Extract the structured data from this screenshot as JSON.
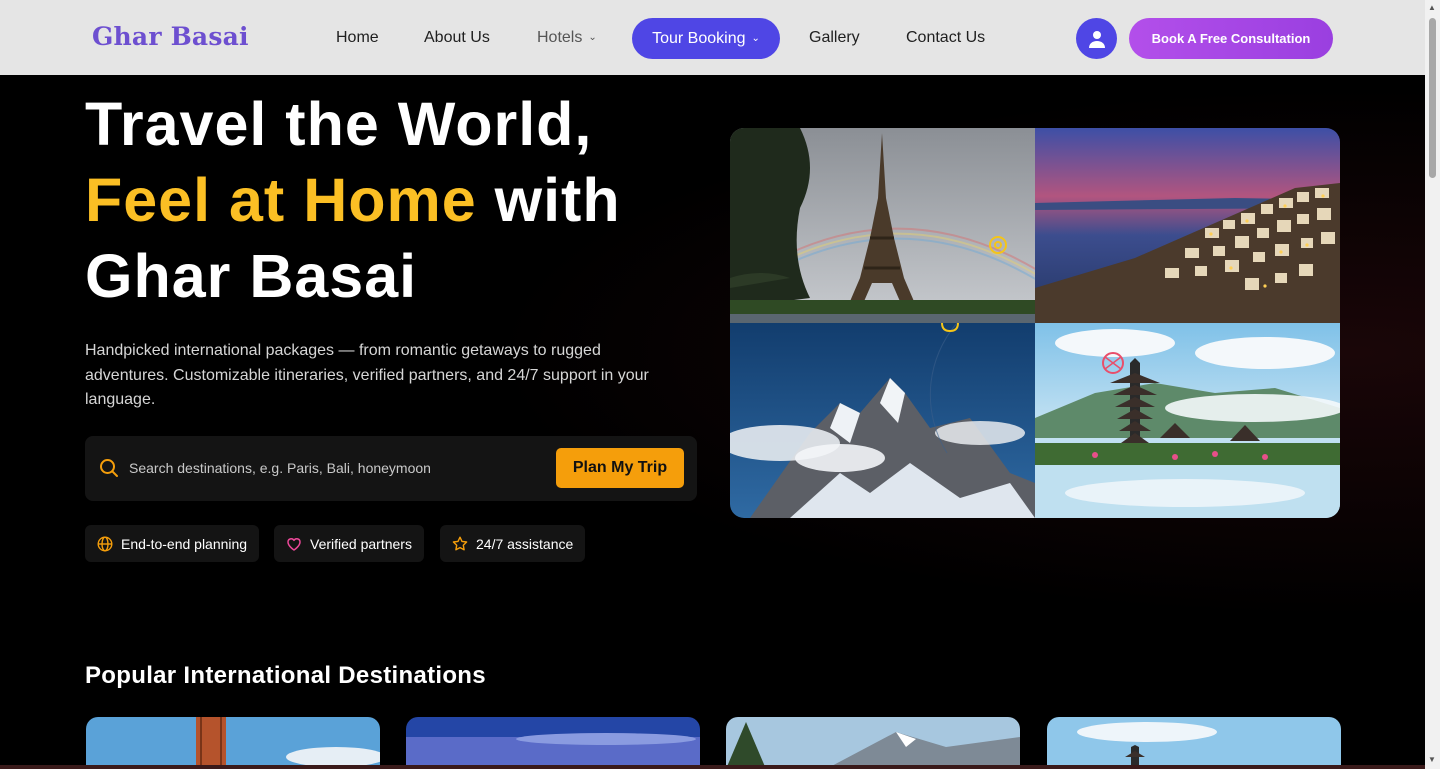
{
  "navbar": {
    "brand": "Ghar Basai",
    "links": {
      "home": "Home",
      "about": "About Us",
      "hotels": "Hotels",
      "tour": "Tour Booking",
      "gallery": "Gallery",
      "contact": "Contact Us"
    },
    "cta": "Book A Free Consultation"
  },
  "hero": {
    "line1": "Travel the World,",
    "line2_accent": "Feel at Home",
    "line2_rest": " with",
    "line3": "Ghar Basai",
    "description": "Handpicked international packages — from romantic getaways to rugged adventures. Customizable itineraries, verified partners, and 24/7 support in your language.",
    "search": {
      "placeholder": "Search destinations, e.g. Paris, Bali, honeymoon",
      "button": "Plan My Trip"
    },
    "features": [
      "End-to-end planning",
      "Verified partners",
      "24/7 assistance"
    ]
  },
  "popular": {
    "title": "Popular International Destinations"
  },
  "colors": {
    "accent": "#fbbf24",
    "primary": "#4f46e5",
    "cta": "#a855f7",
    "button": "#f59e0b"
  }
}
